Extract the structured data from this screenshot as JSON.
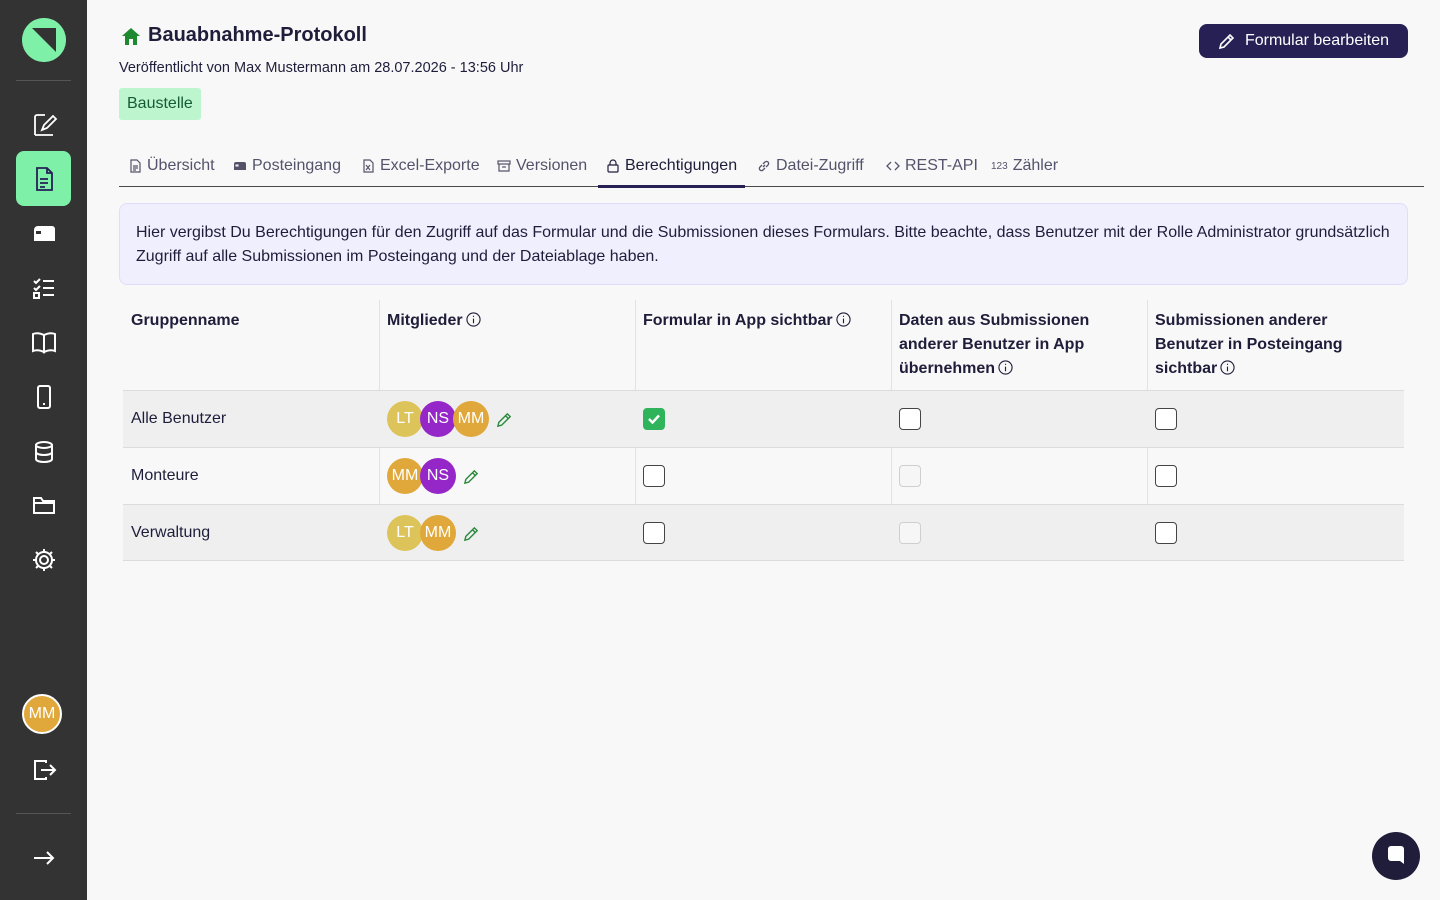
{
  "header": {
    "title": "Bauabnahme-Protokoll",
    "published": "Veröffentlicht von Max Mustermann am 28.07.2026 - 13:56 Uhr",
    "tag": "Baustelle",
    "edit_button": "Formular bearbeiten"
  },
  "sidebar": {
    "user_initials": "MM",
    "items": [
      {
        "icon": "form-edit-icon"
      },
      {
        "icon": "document-icon",
        "active": true
      },
      {
        "icon": "inbox-icon"
      },
      {
        "icon": "checklist-icon"
      },
      {
        "icon": "book-icon"
      },
      {
        "icon": "phone-icon"
      },
      {
        "icon": "database-icon"
      },
      {
        "icon": "folder-icon"
      },
      {
        "icon": "gear-icon"
      }
    ]
  },
  "tabs": [
    {
      "label": "Übersicht",
      "icon": "file-icon"
    },
    {
      "label": "Posteingang",
      "icon": "inbox-icon"
    },
    {
      "label": "Excel-Exporte",
      "icon": "excel-file-icon"
    },
    {
      "label": "Versionen",
      "icon": "archive-icon"
    },
    {
      "label": "Berechtigungen",
      "icon": "lock-icon",
      "active": true
    },
    {
      "label": "Datei-Zugriff",
      "icon": "link-icon"
    },
    {
      "label": "REST-API",
      "icon": "code-icon"
    },
    {
      "label": "Zähler",
      "icon": "number-icon",
      "icon_text": "123"
    }
  ],
  "info_text": "Hier vergibst Du Berechtigungen für den Zugriff auf das Formular und die Submissionen dieses Formulars. Bitte beachte, dass Benutzer mit der Rolle Administrator grundsätzlich Zugriff auf alle Submissionen im Posteingang und der Dateiablage haben.",
  "table": {
    "headers": [
      {
        "label": "Gruppenname",
        "info": false
      },
      {
        "label": "Mitglieder",
        "info": true
      },
      {
        "label": "Formular in App sichtbar",
        "info": true
      },
      {
        "label": "Daten aus Submissionen anderer Benutzer in App übernehmen",
        "info": true
      },
      {
        "label": "Submissionen anderer Benutzer in Posteingang sichtbar",
        "info": true
      }
    ],
    "rows": [
      {
        "name": "Alle Benutzer",
        "members": [
          {
            "initials": "LT",
            "color": "#dcc35a"
          },
          {
            "initials": "NS",
            "color": "#9526c8"
          },
          {
            "initials": "MM",
            "color": "#e0a83a"
          }
        ],
        "visible_in_app": "checked",
        "take_over_data": "unchecked",
        "inbox_visible": "unchecked"
      },
      {
        "name": "Monteure",
        "members": [
          {
            "initials": "MM",
            "color": "#e0a83a"
          },
          {
            "initials": "NS",
            "color": "#9526c8"
          }
        ],
        "visible_in_app": "unchecked",
        "take_over_data": "disabled",
        "inbox_visible": "unchecked"
      },
      {
        "name": "Verwaltung",
        "members": [
          {
            "initials": "LT",
            "color": "#dcc35a"
          },
          {
            "initials": "MM",
            "color": "#e0a83a"
          }
        ],
        "visible_in_app": "unchecked",
        "take_over_data": "disabled",
        "inbox_visible": "unchecked"
      }
    ]
  },
  "colors": {
    "accent_green": "#7ef0a8",
    "primary_dark": "#262055",
    "check_green": "#2fb45c"
  }
}
